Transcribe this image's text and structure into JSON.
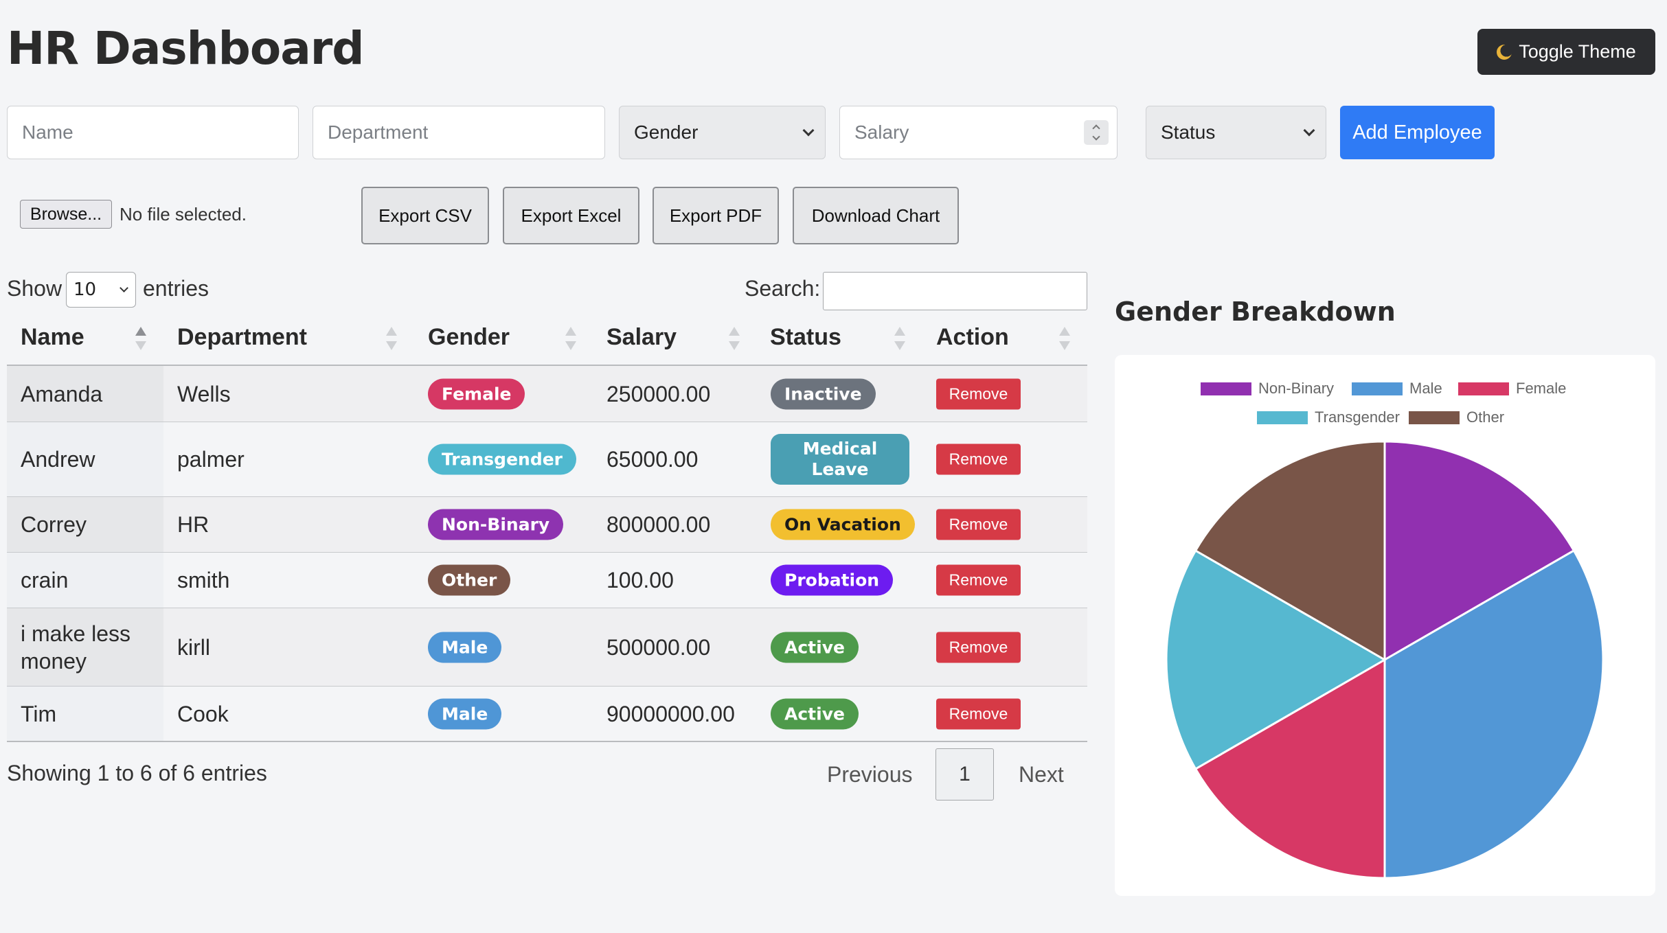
{
  "header": {
    "title": "HR Dashboard",
    "toggle_theme_label": "Toggle Theme"
  },
  "form": {
    "name_placeholder": "Name",
    "department_placeholder": "Department",
    "gender_selected": "Gender",
    "salary_placeholder": "Salary",
    "status_selected": "Status",
    "add_label": "Add Employee"
  },
  "file": {
    "browse_label": "Browse...",
    "status": "No file selected."
  },
  "exports": {
    "csv": "Export CSV",
    "excel": "Export Excel",
    "pdf": "Export PDF",
    "chart": "Download Chart"
  },
  "table_controls": {
    "show_label": "Show",
    "entries_value": "10",
    "entries_label": "entries",
    "search_label": "Search:"
  },
  "table": {
    "columns": [
      "Name",
      "Department",
      "Gender",
      "Salary",
      "Status",
      "Action"
    ],
    "rows": [
      {
        "name": "Amanda",
        "department": "Wells",
        "gender": "Female",
        "salary": "250000.00",
        "status": "Inactive",
        "action": "Remove"
      },
      {
        "name": "Andrew",
        "department": "palmer",
        "gender": "Transgender",
        "salary": "65000.00",
        "status": "Medical Leave",
        "action": "Remove"
      },
      {
        "name": "Correy",
        "department": "HR",
        "gender": "Non-Binary",
        "salary": "800000.00",
        "status": "On Vacation",
        "action": "Remove"
      },
      {
        "name": "crain",
        "department": "smith",
        "gender": "Other",
        "salary": "100.00",
        "status": "Probation",
        "action": "Remove"
      },
      {
        "name": "i make less money",
        "department": "kirll",
        "gender": "Male",
        "salary": "500000.00",
        "status": "Active",
        "action": "Remove"
      },
      {
        "name": "Tim",
        "department": "Cook",
        "gender": "Male",
        "salary": "90000000.00",
        "status": "Active",
        "action": "Remove"
      }
    ]
  },
  "footer": {
    "info": "Showing 1 to 6 of 6 entries",
    "previous": "Previous",
    "page": "1",
    "next": "Next"
  },
  "colors": {
    "Female": "#d63864",
    "Transgender": "#4fb8cf",
    "Non-Binary": "#8e33b0",
    "Other": "#7a5548",
    "Male": "#4f96d6",
    "Inactive": "#6c737d",
    "Medical Leave": "#4a9fb3",
    "On Vacation": "#f2bf2f",
    "Probation": "#6d1cf0",
    "Active": "#4e9a4b",
    "accent": "#2f7bf5",
    "remove": "#d63a46"
  },
  "chart_section": {
    "title": "Gender Breakdown"
  },
  "chart_data": {
    "type": "pie",
    "categories": [
      "Non-Binary",
      "Male",
      "Female",
      "Transgender",
      "Other"
    ],
    "values": [
      1,
      2,
      1,
      1,
      1
    ],
    "colors": [
      "#9130b0",
      "#5297d6",
      "#d73865",
      "#56b8d0",
      "#795548"
    ],
    "legend": "top"
  }
}
